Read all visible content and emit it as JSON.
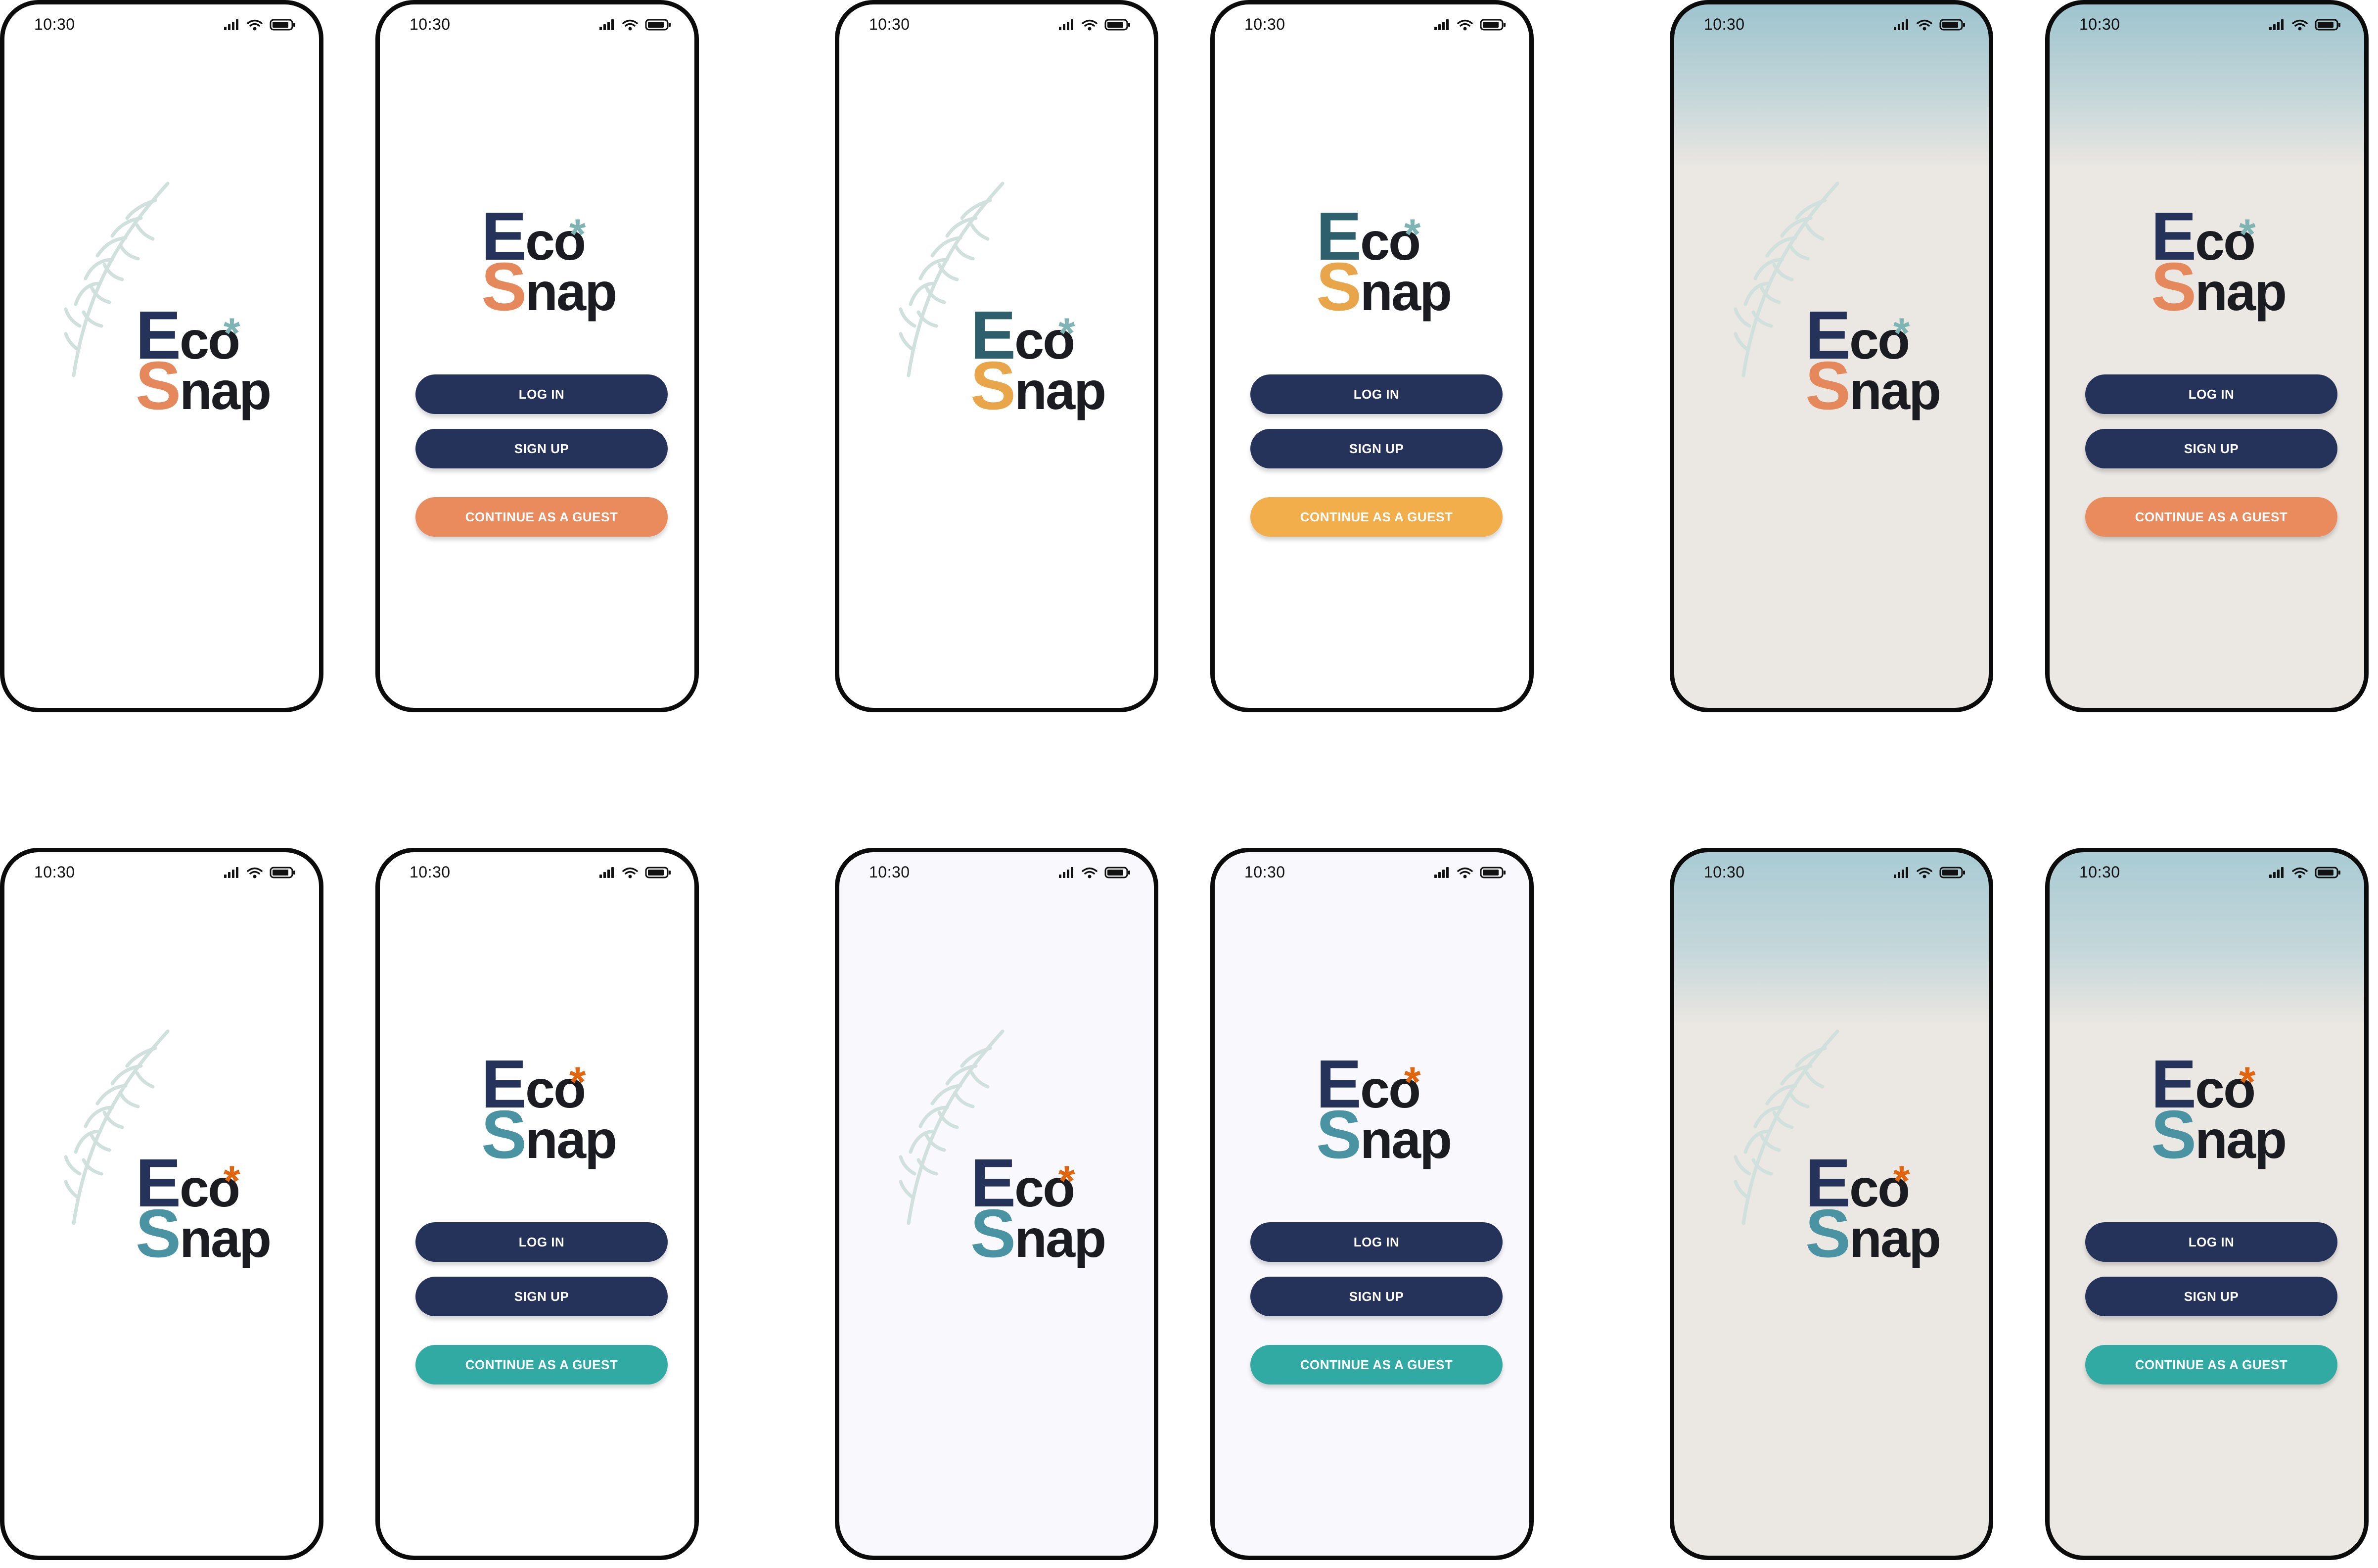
{
  "status_bar": {
    "time": "10:30"
  },
  "logo": {
    "word1": "Eco",
    "word2": "Snap",
    "asterisk": "*"
  },
  "buttons": {
    "login": "LOG IN",
    "signup": "SIGN UP",
    "guest": "CONTINUE AS A GUEST"
  },
  "colors": {
    "navy": "#25325a",
    "orange_s": "#e5895c",
    "mustard_s": "#e9a54a",
    "teal_s": "#4a93a3",
    "teal_dark_e": "#2e5f6c",
    "asterisk_teal": "#7fb4b4",
    "asterisk_orange": "#e0650e",
    "guest_orange": "#ea8b5e",
    "guest_yellow": "#f2ae4a",
    "guest_teal": "#30aaa2",
    "fern": "#cfe0dd"
  },
  "icons": [
    "signal-icon",
    "wifi-icon",
    "battery-icon",
    "fern-illustration"
  ]
}
